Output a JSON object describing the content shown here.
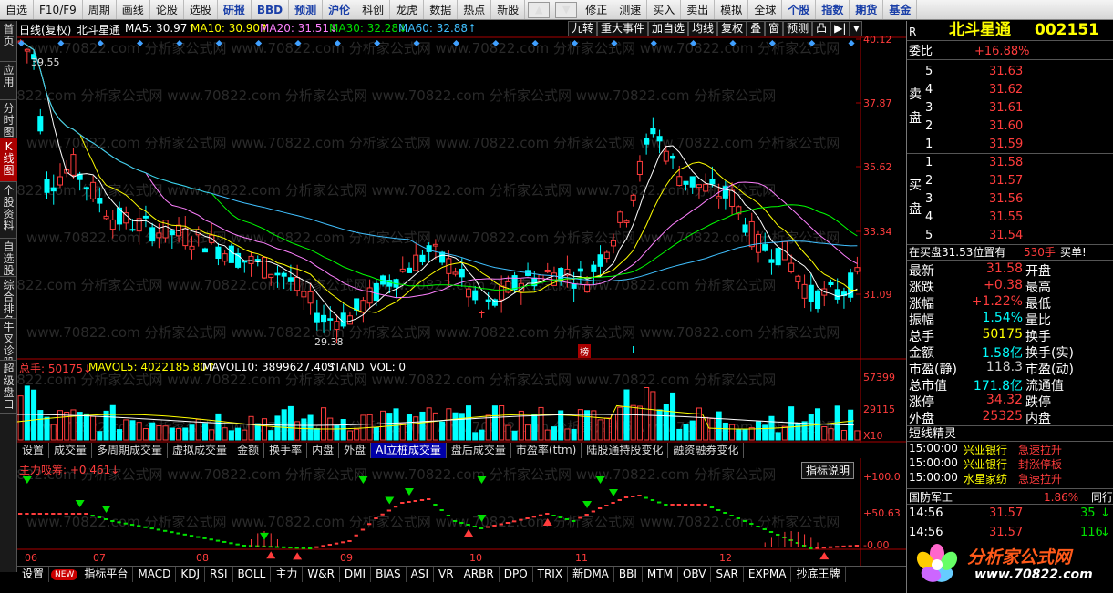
{
  "menu": {
    "items": [
      "自选",
      "F10/F9",
      "周期",
      "画线",
      "论股",
      "选股",
      "研报",
      "BBD",
      "预测",
      "沪伦",
      "科创",
      "龙虎",
      "数据",
      "热点",
      "新股",
      "修正",
      "测速",
      "买入",
      "卖出",
      "模拟",
      "全球",
      "个股",
      "指数",
      "期货",
      "基金"
    ]
  },
  "sidebar": {
    "tabs": [
      "首页",
      "应用",
      "分时图",
      "K线图",
      "个股资料",
      "自选股",
      "综合排名",
      "牛叉诊股",
      "超级盘口"
    ],
    "active": 3
  },
  "kline": {
    "legend": {
      "mode": "日线(复权)",
      "name": "北斗星通",
      "ma5": "MA5: 30.97↑",
      "ma10": "MA10: 30.90↑",
      "ma20": "MA20: 31.51↓",
      "ma30": "MA30: 32.28↓",
      "ma60": "MA60: 32.88↑"
    },
    "buttons": [
      "九转",
      "重大事件",
      "加自选",
      "均线",
      "复权",
      "叠",
      "窗",
      "预测",
      "凸",
      "▶|",
      "▾"
    ],
    "price_axis": [
      "40.12",
      "37.87",
      "35.62",
      "33.34",
      "31.09"
    ],
    "hi_label": "39.55",
    "lo_label": "29.38",
    "tag_bang": "榜",
    "tag_l": "L",
    "watermark": "www.70822.com 分析家公式网"
  },
  "volume": {
    "legend": {
      "total": "总手: 50175↓",
      "mavol5": "MAVOL5: 4022185.80↑",
      "mavol10": "MAVOL10: 3899627.40↑",
      "stand": "STAND_VOL: 0"
    },
    "axis": [
      "57399",
      "29115",
      "X10"
    ]
  },
  "ind_tabs": {
    "items": [
      "设置",
      "成交量",
      "多周期成交量",
      "虚拟成交量",
      "金额",
      "换手率",
      "内盘",
      "外盘",
      "AI立桩成交量",
      "盘后成交量",
      "市盈率(ttm)",
      "陆股通持股变化",
      "融资融券变化"
    ],
    "active": 8
  },
  "indicator": {
    "title": "主力吸筹: +0.461↓",
    "explain_btn": "指标说明",
    "axis": [
      "+100.0",
      "+50.63",
      "-0.00"
    ]
  },
  "dates": [
    "06",
    "07",
    "08",
    "09",
    "10",
    "11",
    "12"
  ],
  "bottom_tabs": {
    "items": [
      "设置",
      "NEW",
      "指标平台",
      "MACD",
      "KDJ",
      "RSI",
      "BOLL",
      "主力",
      "W&R",
      "DMI",
      "BIAS",
      "ASI",
      "VR",
      "ARBR",
      "DPO",
      "TRIX",
      "新DMA",
      "BBI",
      "MTM",
      "OBV",
      "SAR",
      "EXPMA",
      "抄底王牌"
    ]
  },
  "quote": {
    "title": "北斗星通",
    "code": "002151",
    "r": "R",
    "weibi_label": "委比",
    "weibi": "+16.88%",
    "sell_label": "卖盘",
    "buy_label": "买盘",
    "sells": [
      {
        "n": "5",
        "p": "31.63"
      },
      {
        "n": "4",
        "p": "31.62"
      },
      {
        "n": "3",
        "p": "31.61"
      },
      {
        "n": "2",
        "p": "31.60"
      },
      {
        "n": "1",
        "p": "31.59"
      }
    ],
    "buys": [
      {
        "n": "1",
        "p": "31.58"
      },
      {
        "n": "2",
        "p": "31.57"
      },
      {
        "n": "3",
        "p": "31.56"
      },
      {
        "n": "4",
        "p": "31.55"
      },
      {
        "n": "5",
        "p": "31.54"
      }
    ],
    "buy_order": {
      "text": "在买盘31.53位置有",
      "qty": "530手",
      "tag": "买单!"
    },
    "stats": [
      {
        "l": "最新",
        "v": "31.58",
        "r": "开盘",
        "c": "red"
      },
      {
        "l": "涨跌",
        "v": "+0.38",
        "r": "最高",
        "c": "red"
      },
      {
        "l": "涨幅",
        "v": "+1.22%",
        "r": "最低",
        "c": "red"
      },
      {
        "l": "振幅",
        "v": "1.54%",
        "r": "量比",
        "c": "cyan"
      },
      {
        "l": "总手",
        "v": "50175",
        "r": "换手",
        "c": "yellow"
      },
      {
        "l": "金额",
        "v": "1.58亿",
        "r": "换手(实)",
        "c": "cyan"
      },
      {
        "l": "市盈(静)",
        "v": "118.3",
        "r": "市盈(动)",
        "c": "gray"
      },
      {
        "l": "总市值",
        "v": "171.8亿",
        "r": "流通值",
        "c": "cyan"
      },
      {
        "l": "涨停",
        "v": "34.32",
        "r": "跌停",
        "c": "red"
      },
      {
        "l": "外盘",
        "v": "25325",
        "r": "内盘",
        "c": "red"
      }
    ],
    "short_title": "短线精灵",
    "short": [
      {
        "t": "15:00:00",
        "n": "兴业银行",
        "e": "急速拉升"
      },
      {
        "t": "15:00:00",
        "n": "兴业银行",
        "e": "封涨停板"
      },
      {
        "t": "15:00:00",
        "n": "水星家纺",
        "e": "急速拉升"
      }
    ],
    "sector": {
      "name": "国防军工",
      "chg": "1.86%",
      "peer": "同行"
    },
    "ticks": [
      {
        "t": "14:56",
        "p": "31.57",
        "v": "35"
      },
      {
        "t": "14:56",
        "p": "31.57",
        "v": "116"
      }
    ],
    "logo": "分析家公式网",
    "logo_url": "www.70822.com"
  },
  "colors": {
    "up": "#ff3c3c",
    "down": "#00ffff",
    "ma5": "#ffffff",
    "ma10": "#ffff00",
    "ma20": "#ff80ff",
    "ma30": "#00ff00",
    "ma60": "#40c0ff"
  }
}
